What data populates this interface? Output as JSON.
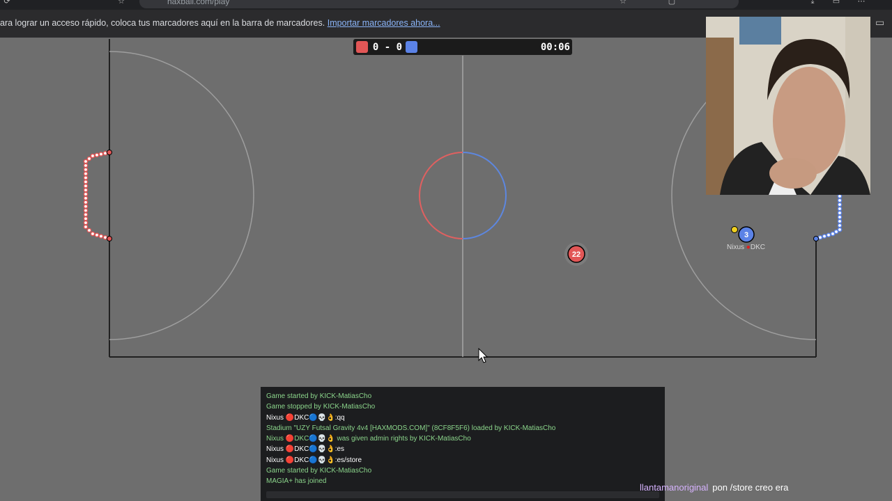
{
  "browser": {
    "url": "haxball.com/play",
    "bookmarks_text": "ara lograr un acceso rápido, coloca tus marcadores aquí en la barra de marcadores.",
    "bookmarks_link": "Importar marcadores ahora..."
  },
  "scoreboard": {
    "red_color": "#e25656",
    "blue_color": "#5b82e6",
    "score": "0 - 0",
    "time": "00:06"
  },
  "players": [
    {
      "number": "22",
      "team": "red"
    },
    {
      "number": "3",
      "team": "blue",
      "name": "Nixus",
      "tag": "DKC"
    }
  ],
  "chat": {
    "lines": [
      {
        "type": "system",
        "text": "Game started by KICK-MatiasCho"
      },
      {
        "type": "system",
        "text": "Game stopped by KICK-MatiasCho"
      },
      {
        "type": "user",
        "text": "Nixus 🔴DKC🔵💀👌:qq"
      },
      {
        "type": "system",
        "text": "Stadium \"UZY Futsal Gravity 4v4 [HAXMODS.COM]\" (8CF8F5F6) loaded by KICK-MatiasCho"
      },
      {
        "type": "system",
        "text": "Nixus 🔴DKC🔵💀👌 was given admin rights by KICK-MatiasCho"
      },
      {
        "type": "user",
        "text": "Nixus 🔴DKC🔵💀👌:es"
      },
      {
        "type": "user",
        "text": "Nixus 🔴DKC🔵💀👌:es/store"
      },
      {
        "type": "system",
        "text": "Game started by KICK-MatiasCho"
      },
      {
        "type": "system",
        "text": "MAGIA+ has joined"
      }
    ]
  },
  "stream_chat": {
    "user": "llantamanoriginal",
    "message": "pon /store creo era"
  }
}
